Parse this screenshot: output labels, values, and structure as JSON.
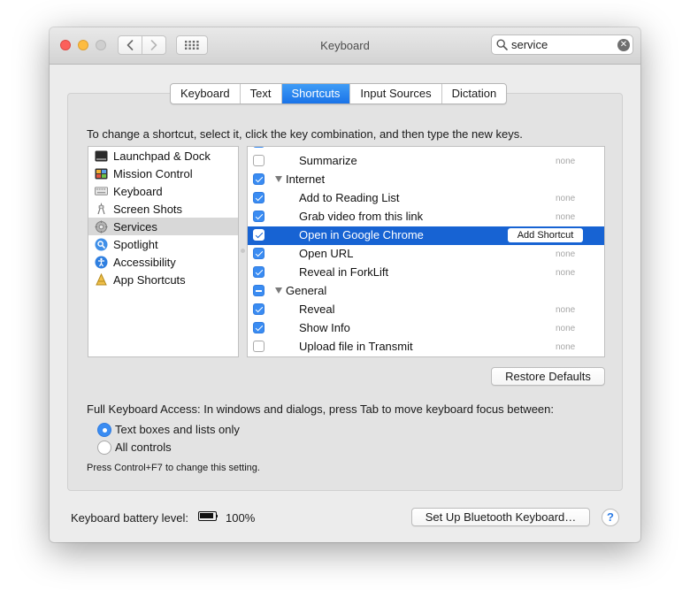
{
  "window": {
    "title": "Keyboard",
    "search_value": "service"
  },
  "tabs": [
    {
      "label": "Keyboard",
      "active": false
    },
    {
      "label": "Text",
      "active": false
    },
    {
      "label": "Shortcuts",
      "active": true
    },
    {
      "label": "Input Sources",
      "active": false
    },
    {
      "label": "Dictation",
      "active": false
    }
  ],
  "instructions": "To change a shortcut, select it, click the key combination, and then type the new keys.",
  "categories": [
    {
      "label": "Launchpad & Dock",
      "icon": "launchpad-icon"
    },
    {
      "label": "Mission Control",
      "icon": "mission-control-icon"
    },
    {
      "label": "Keyboard",
      "icon": "keyboard-icon"
    },
    {
      "label": "Screen Shots",
      "icon": "screenshot-icon"
    },
    {
      "label": "Services",
      "icon": "gear-icon",
      "selected": true
    },
    {
      "label": "Spotlight",
      "icon": "spotlight-icon"
    },
    {
      "label": "Accessibility",
      "icon": "accessibility-icon"
    },
    {
      "label": "App Shortcuts",
      "icon": "app-shortcuts-icon"
    }
  ],
  "shortcuts": [
    {
      "label": "Summarize",
      "checked": "off",
      "shortcut": "none"
    },
    {
      "label": "Internet",
      "checked": "on",
      "group": true
    },
    {
      "label": "Add to Reading List",
      "checked": "on",
      "shortcut": "none"
    },
    {
      "label": "Grab video from this link",
      "checked": "on",
      "shortcut": "none"
    },
    {
      "label": "Open in Google Chrome",
      "checked": "on",
      "selected": true,
      "button": "Add Shortcut"
    },
    {
      "label": "Open URL",
      "checked": "on",
      "shortcut": "none"
    },
    {
      "label": "Reveal in ForkLift",
      "checked": "on",
      "shortcut": "none"
    },
    {
      "label": "General",
      "checked": "mixed",
      "group": true
    },
    {
      "label": "Reveal",
      "checked": "on",
      "shortcut": "none"
    },
    {
      "label": "Show Info",
      "checked": "on",
      "shortcut": "none"
    },
    {
      "label": "Upload file in Transmit",
      "checked": "off",
      "shortcut": "none"
    }
  ],
  "restore_defaults_label": "Restore Defaults",
  "full_keyboard_access": {
    "text": "Full Keyboard Access: In windows and dialogs, press Tab to move keyboard focus between:",
    "options": [
      {
        "label": "Text boxes and lists only",
        "selected": true
      },
      {
        "label": "All controls",
        "selected": false
      }
    ],
    "note": "Press Control+F7 to change this setting."
  },
  "battery": {
    "label": "Keyboard battery level:",
    "value": "100%"
  },
  "bluetooth_button_label": "Set Up Bluetooth Keyboard…",
  "help_label": "?",
  "colors": {
    "accent": "#1a73e8",
    "selection": "#1763d3",
    "checkbox": "#3a8cf2"
  }
}
